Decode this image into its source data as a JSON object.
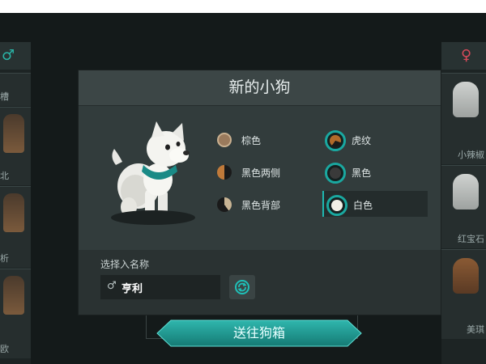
{
  "colors": {
    "teal": "#1aa8a0",
    "female": "#d64a5a"
  },
  "icons": {
    "male_symbol": "male-symbol-icon",
    "female_symbol": "female-symbol-icon",
    "refresh": "refresh-icon"
  },
  "left_list": {
    "items": [
      {
        "label": "槽"
      },
      {
        "label": "北"
      },
      {
        "label": "析"
      },
      {
        "label": "欧"
      }
    ]
  },
  "right_list": {
    "items": [
      {
        "label": "小辣椒"
      },
      {
        "label": "红宝石"
      },
      {
        "label": "美琪"
      }
    ]
  },
  "modal": {
    "title": "新的小狗",
    "color_options_left": [
      {
        "label": "棕色",
        "swatch": "#9a7a5c"
      },
      {
        "label": "黑色两侧",
        "swatch": "#c07a3a"
      },
      {
        "label": "黑色背部",
        "swatch": "#5a5048"
      }
    ],
    "color_options_right": [
      {
        "label": "虎纹",
        "swatch": "#b06a2a"
      },
      {
        "label": "黑色",
        "swatch": "#3a3a3a"
      },
      {
        "label": "白色",
        "swatch": "#f2efe6",
        "selected": true
      }
    ],
    "name_prompt": "选择入名称",
    "name_value": "亨利",
    "gender_symbol": "♂"
  },
  "send_button": {
    "label": "送往狗箱"
  }
}
